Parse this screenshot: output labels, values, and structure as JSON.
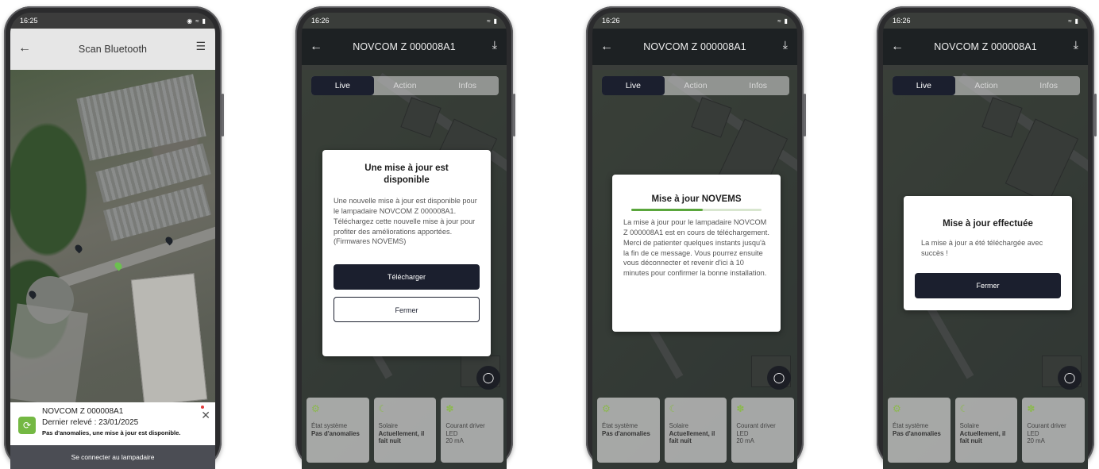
{
  "screens": [
    {
      "status_time": "16:25",
      "header_title": "Scan Bluetooth",
      "device": {
        "name": "NOVCOM Z 000008A1",
        "last_reading": "Dernier relevé : 23/01/2025",
        "status": "Pas d'anomalies, une mise à jour est disponible."
      },
      "connect_label": "Se connecter au lampadaire"
    },
    {
      "status_time": "16:26",
      "header_title": "NOVCOM Z 000008A1",
      "tabs": [
        "Live",
        "Action",
        "Infos"
      ],
      "dialog": {
        "title": "Une mise à jour est disponible",
        "body": "Une nouvelle mise à jour est disponible pour le lampadaire NOVCOM Z 000008A1. Téléchargez cette nouvelle mise à jour pour profiter des améliorations apportées. (Firmwares NOVEMS)",
        "primary_label": "Télécharger",
        "secondary_label": "Fermer"
      },
      "cards": [
        {
          "label": "État système",
          "value": "Pas d'anomalies"
        },
        {
          "label": "Solaire",
          "value": "Actuellement, il fait nuit"
        },
        {
          "label": "Courant driver",
          "value": "LED",
          "value2": "20 mA"
        }
      ]
    },
    {
      "status_time": "16:26",
      "header_title": "NOVCOM Z 000008A1",
      "tabs": [
        "Live",
        "Action",
        "Infos"
      ],
      "dialog": {
        "title": "Mise à jour NOVEMS",
        "progress": 0.55,
        "body": "La mise à jour pour le lampadaire NOVCOM Z 000008A1 est en cours de téléchargement. Merci de patienter quelques instants jusqu'à la fin de ce message. Vous pourrez ensuite vous déconnecter et revenir d'ici à 10 minutes pour confirmer la bonne installation."
      },
      "cards": [
        {
          "label": "État système",
          "value": "Pas d'anomalies"
        },
        {
          "label": "Solaire",
          "value": "Actuellement, il fait nuit"
        },
        {
          "label": "Courant driver",
          "value": "LED",
          "value2": "20 mA"
        }
      ]
    },
    {
      "status_time": "16:26",
      "header_title": "NOVCOM Z 000008A1",
      "tabs": [
        "Live",
        "Action",
        "Infos"
      ],
      "dialog": {
        "title": "Mise à jour effectuée",
        "body": "La mise à jour a été téléchargée avec succès !",
        "primary_label": "Fermer"
      },
      "cards": [
        {
          "label": "État système",
          "value": "Pas d'anomalies"
        },
        {
          "label": "Solaire",
          "value": "Actuellement, il fait nuit"
        },
        {
          "label": "Courant driver",
          "value": "LED",
          "value2": "20 mA"
        }
      ]
    }
  ],
  "icons": {
    "back": "arrow-left-icon",
    "menu": "list-icon",
    "download": "download-icon",
    "settings": "gear-icon",
    "night": "moon-icon",
    "led": "bulb-icon",
    "device_logo": "refresh-icon",
    "close": "close-icon",
    "headset": "headset-icon"
  },
  "colors": {
    "brand_dark": "#1b1f2e",
    "accent_green": "#74b843",
    "progress_green": "#5aa63c",
    "alert_red": "#e23b3b"
  }
}
